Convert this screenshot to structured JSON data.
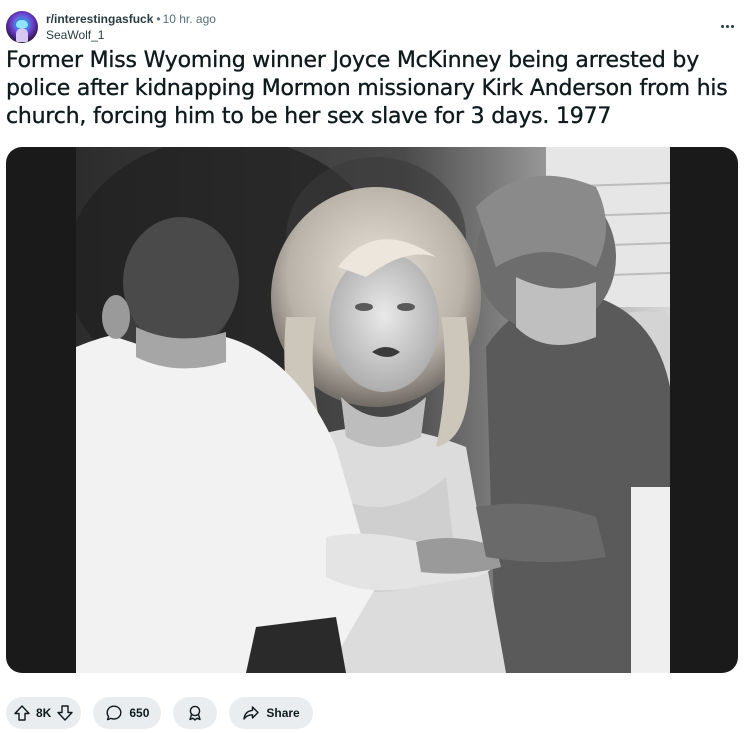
{
  "post": {
    "subreddit": "r/interestingasfuck",
    "separator": "•",
    "time_ago": "10 hr. ago",
    "author": "SeaWolf_1",
    "title": "Former Miss Wyoming winner Joyce McKinney being arrested by police after kidnapping Mormon missionary Kirk Anderson from his church, forcing him to be her sex slave for 3 days. 1977",
    "image_alt": "Former Miss Wyoming winner Joyce McKinney being arrested by police after kidnapping Mormon missionary Kirk Anderson from his church, forcing him to be her sex slave for 3 days. 1977"
  },
  "actions": {
    "upvote_count": "8K",
    "comment_count": "650",
    "share_label": "Share"
  },
  "icons": {
    "avatar": "subreddit-avatar-icon",
    "more": "more-options-icon",
    "upvote": "upvote-arrow-icon",
    "downvote": "downvote-arrow-icon",
    "comment": "comment-bubble-icon",
    "award": "award-icon",
    "share": "share-arrow-icon"
  },
  "colors": {
    "action_pill_bg": "#eaedef",
    "meta_text": "#576f76",
    "title_text": "#0f1a1c"
  }
}
